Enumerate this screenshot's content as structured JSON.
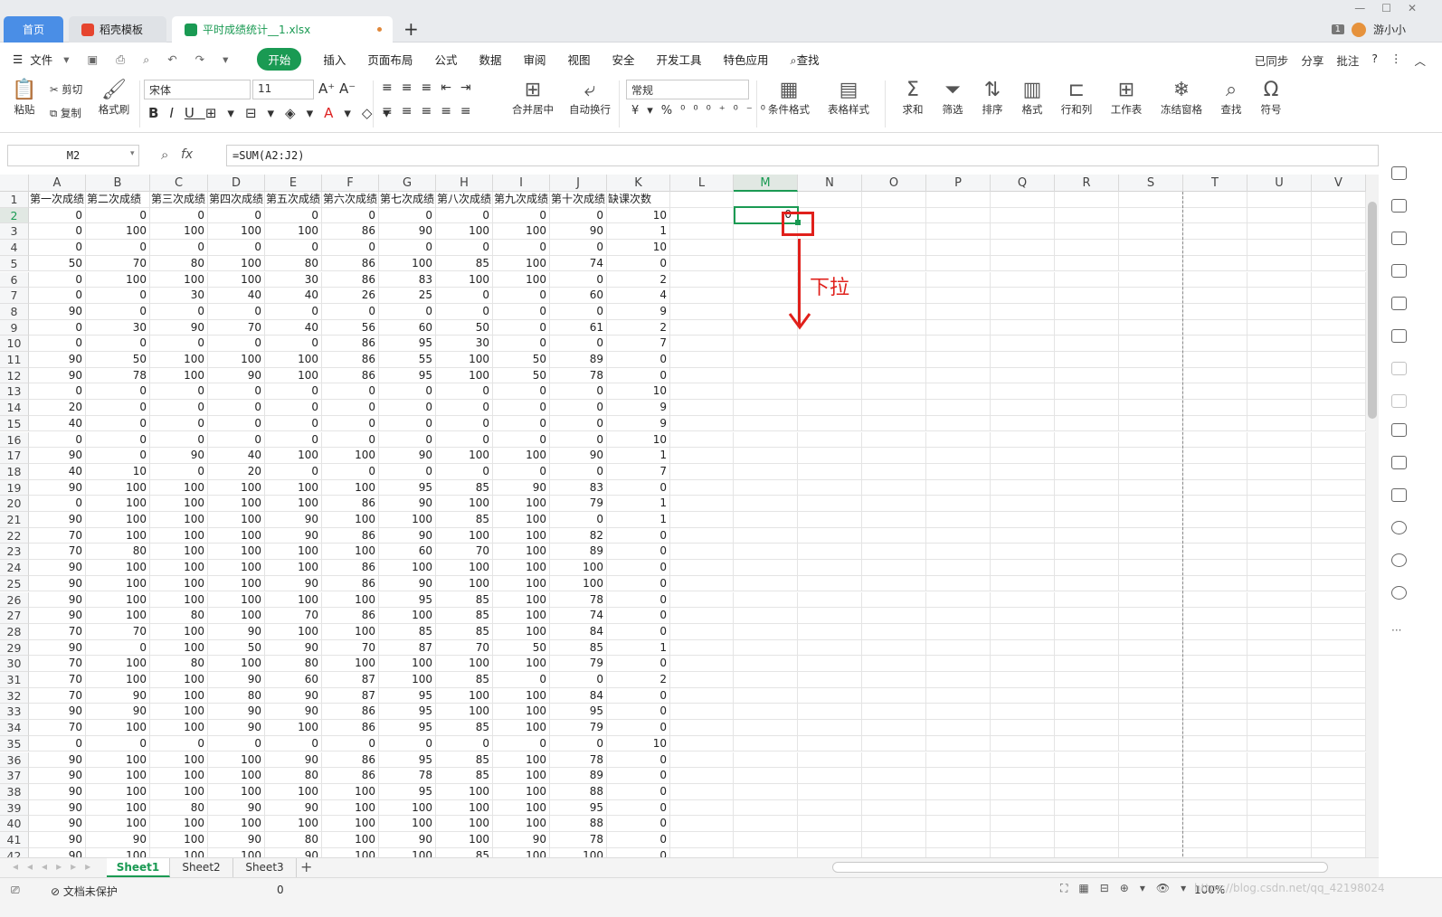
{
  "tabs": {
    "home": "首页",
    "docer": "稻壳模板",
    "file": "平时成绩统计__1.xlsx",
    "user": "游小小",
    "badge": "1"
  },
  "menu": {
    "file": "文件",
    "start": "开始",
    "items": [
      "插入",
      "页面布局",
      "公式",
      "数据",
      "审阅",
      "视图",
      "安全",
      "开发工具",
      "特色应用"
    ],
    "search": "查找",
    "right": [
      "已同步",
      "分享",
      "批注"
    ]
  },
  "ribbon": {
    "paste": "粘贴",
    "cut": "剪切",
    "copy": "复制",
    "format_painter": "格式刷",
    "font_name": "宋体",
    "font_size": "11",
    "number_format": "常规",
    "merge": "合并居中",
    "wrap": "自动换行",
    "cond_format": "条件格式",
    "table_style": "表格样式",
    "sum": "求和",
    "filter": "筛选",
    "sort": "排序",
    "format": "格式",
    "row_col": "行和列",
    "worksheet": "工作表",
    "freeze": "冻结窗格",
    "find": "查找",
    "symbol": "符号"
  },
  "formula_bar": {
    "name_box": "M2",
    "fx": "fx",
    "formula": "=SUM(A2:J2)"
  },
  "columns": [
    "A",
    "B",
    "C",
    "D",
    "E",
    "F",
    "G",
    "H",
    "I",
    "J",
    "K",
    "L",
    "M",
    "N",
    "O",
    "P",
    "Q",
    "R",
    "S",
    "T",
    "U",
    "V"
  ],
  "header_row": [
    "第一次成绩",
    "第二次成绩",
    "第三次成绩",
    "第四次成绩",
    "第五次成绩",
    "第六次成绩",
    "第七次成绩",
    "第八次成绩",
    "第九次成绩",
    "第十次成绩",
    "缺课次数"
  ],
  "rows": [
    [
      0,
      0,
      0,
      0,
      0,
      0,
      0,
      0,
      0,
      0,
      10
    ],
    [
      0,
      100,
      100,
      100,
      100,
      86,
      90,
      100,
      100,
      90,
      1
    ],
    [
      0,
      0,
      0,
      0,
      0,
      0,
      0,
      0,
      0,
      0,
      10
    ],
    [
      50,
      70,
      80,
      100,
      80,
      86,
      100,
      85,
      100,
      74,
      0
    ],
    [
      0,
      100,
      100,
      100,
      30,
      86,
      83,
      100,
      100,
      0,
      2
    ],
    [
      0,
      0,
      30,
      40,
      40,
      26,
      25,
      0,
      0,
      60,
      4
    ],
    [
      90,
      0,
      0,
      0,
      0,
      0,
      0,
      0,
      0,
      0,
      9
    ],
    [
      0,
      30,
      90,
      70,
      40,
      56,
      60,
      50,
      0,
      61,
      2
    ],
    [
      0,
      0,
      0,
      0,
      0,
      86,
      95,
      30,
      0,
      0,
      7
    ],
    [
      90,
      50,
      100,
      100,
      100,
      86,
      55,
      100,
      50,
      89,
      0
    ],
    [
      90,
      78,
      100,
      90,
      100,
      86,
      95,
      100,
      50,
      78,
      0
    ],
    [
      0,
      0,
      0,
      0,
      0,
      0,
      0,
      0,
      0,
      0,
      10
    ],
    [
      20,
      0,
      0,
      0,
      0,
      0,
      0,
      0,
      0,
      0,
      9
    ],
    [
      40,
      0,
      0,
      0,
      0,
      0,
      0,
      0,
      0,
      0,
      9
    ],
    [
      0,
      0,
      0,
      0,
      0,
      0,
      0,
      0,
      0,
      0,
      10
    ],
    [
      90,
      0,
      90,
      40,
      100,
      100,
      90,
      100,
      100,
      90,
      1
    ],
    [
      40,
      10,
      0,
      20,
      0,
      0,
      0,
      0,
      0,
      0,
      7
    ],
    [
      90,
      100,
      100,
      100,
      100,
      100,
      95,
      85,
      90,
      83,
      0
    ],
    [
      0,
      100,
      100,
      100,
      100,
      86,
      90,
      100,
      100,
      79,
      1
    ],
    [
      90,
      100,
      100,
      100,
      90,
      100,
      100,
      85,
      100,
      0,
      1
    ],
    [
      70,
      100,
      100,
      100,
      90,
      86,
      90,
      100,
      100,
      82,
      0
    ],
    [
      70,
      80,
      100,
      100,
      100,
      100,
      60,
      70,
      100,
      89,
      0
    ],
    [
      90,
      100,
      100,
      100,
      100,
      86,
      100,
      100,
      100,
      100,
      0
    ],
    [
      90,
      100,
      100,
      100,
      90,
      86,
      90,
      100,
      100,
      100,
      0
    ],
    [
      90,
      100,
      100,
      100,
      100,
      100,
      95,
      85,
      100,
      78,
      0
    ],
    [
      90,
      100,
      80,
      100,
      70,
      86,
      100,
      85,
      100,
      74,
      0
    ],
    [
      70,
      70,
      100,
      90,
      100,
      100,
      85,
      85,
      100,
      84,
      0
    ],
    [
      90,
      0,
      100,
      50,
      90,
      70,
      87,
      70,
      50,
      85,
      1
    ],
    [
      70,
      100,
      80,
      100,
      80,
      100,
      100,
      100,
      100,
      79,
      0
    ],
    [
      70,
      100,
      100,
      90,
      60,
      87,
      100,
      85,
      0,
      0,
      2
    ],
    [
      70,
      90,
      100,
      80,
      90,
      87,
      95,
      100,
      100,
      84,
      0
    ],
    [
      90,
      90,
      100,
      90,
      90,
      86,
      95,
      100,
      100,
      95,
      0
    ],
    [
      70,
      100,
      100,
      90,
      100,
      86,
      95,
      85,
      100,
      79,
      0
    ],
    [
      0,
      0,
      0,
      0,
      0,
      0,
      0,
      0,
      0,
      0,
      10
    ],
    [
      90,
      100,
      100,
      100,
      90,
      86,
      95,
      85,
      100,
      78,
      0
    ],
    [
      90,
      100,
      100,
      100,
      80,
      86,
      78,
      85,
      100,
      89,
      0
    ],
    [
      90,
      100,
      100,
      100,
      100,
      100,
      95,
      100,
      100,
      88,
      0
    ],
    [
      90,
      100,
      80,
      90,
      90,
      100,
      100,
      100,
      100,
      95,
      0
    ],
    [
      90,
      100,
      100,
      100,
      100,
      100,
      100,
      100,
      100,
      88,
      0
    ],
    [
      90,
      90,
      100,
      90,
      80,
      100,
      90,
      100,
      90,
      78,
      0
    ],
    [
      90,
      100,
      100,
      100,
      90,
      100,
      100,
      85,
      100,
      100,
      0
    ]
  ],
  "m2_value": "0",
  "annotation": "下拉",
  "sheets": [
    "Sheet1",
    "Sheet2",
    "Sheet3"
  ],
  "status": {
    "protect": "文档未保护",
    "value": "0",
    "zoom": "100%"
  },
  "watermark": "https://blog.csdn.net/qq_42198024"
}
